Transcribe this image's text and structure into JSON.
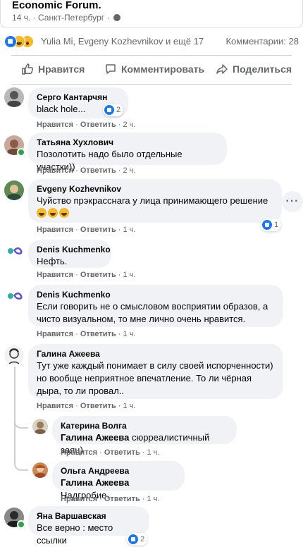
{
  "post": {
    "title": "Economic Forum.",
    "time": "14 ч.",
    "location": "Санкт-Петербург"
  },
  "reactions": {
    "icons": [
      "like-icon",
      "laugh-icon",
      "wow-icon"
    ],
    "reactors": "Yulia Mi, Evgeny Kozhevnikov и ещё 17",
    "comments_count": "Комментарии: 28"
  },
  "actions": {
    "like": "Нравится",
    "comment": "Комментировать",
    "share": "Поделиться"
  },
  "labels": {
    "like": "Нравится",
    "reply": "Ответить"
  },
  "comments": [
    {
      "author": "Серго Кантарчян",
      "text": "black hole...",
      "time": "2 ч.",
      "reactions": "2"
    },
    {
      "author": "Татьяна Хухлович",
      "text": "Позолотить надо было отдельные участки))",
      "time": "2 ч."
    },
    {
      "author": "Evgeny Kozhevnikov",
      "text": "Чуйство прэкрасснага у лица принимающего решение",
      "time": "1 ч.",
      "reactions": "1"
    },
    {
      "author": "Denis Kuchmenko",
      "text": "Нефть.",
      "time": "1 ч."
    },
    {
      "author": "Denis Kuchmenko",
      "text_lines": [
        "Если говорить не о смысловом восприятии образов, а",
        "чисто визуальном, то мне лично очень нравится."
      ],
      "time": "1 ч."
    },
    {
      "author": "Галина Ажеева",
      "text_lines": [
        "Тут уже каждый понимает в силу своей испорченности)",
        "но вообще неприятное впечатление. То ли чёрная",
        "дыра, то ли провал.."
      ],
      "time": "1 ч."
    },
    {
      "author": "Катерина Волга",
      "mention": "Галина Ажеева",
      "text": "сюрреалистичный заяц)",
      "time": "1 ч."
    },
    {
      "author": "Ольга Андреева",
      "mention": "Галина Ажеева",
      "text": "Надгробие.",
      "time": "1 ч."
    },
    {
      "author": "Яна Варшавская",
      "text": "Все верно : место ссылки",
      "reactions": "2"
    }
  ],
  "colors": {
    "link_blue": "#1877f2",
    "bubble_bg": "#f0f2f5",
    "secondary_text": "#65676b",
    "online_green": "#31a24c"
  }
}
